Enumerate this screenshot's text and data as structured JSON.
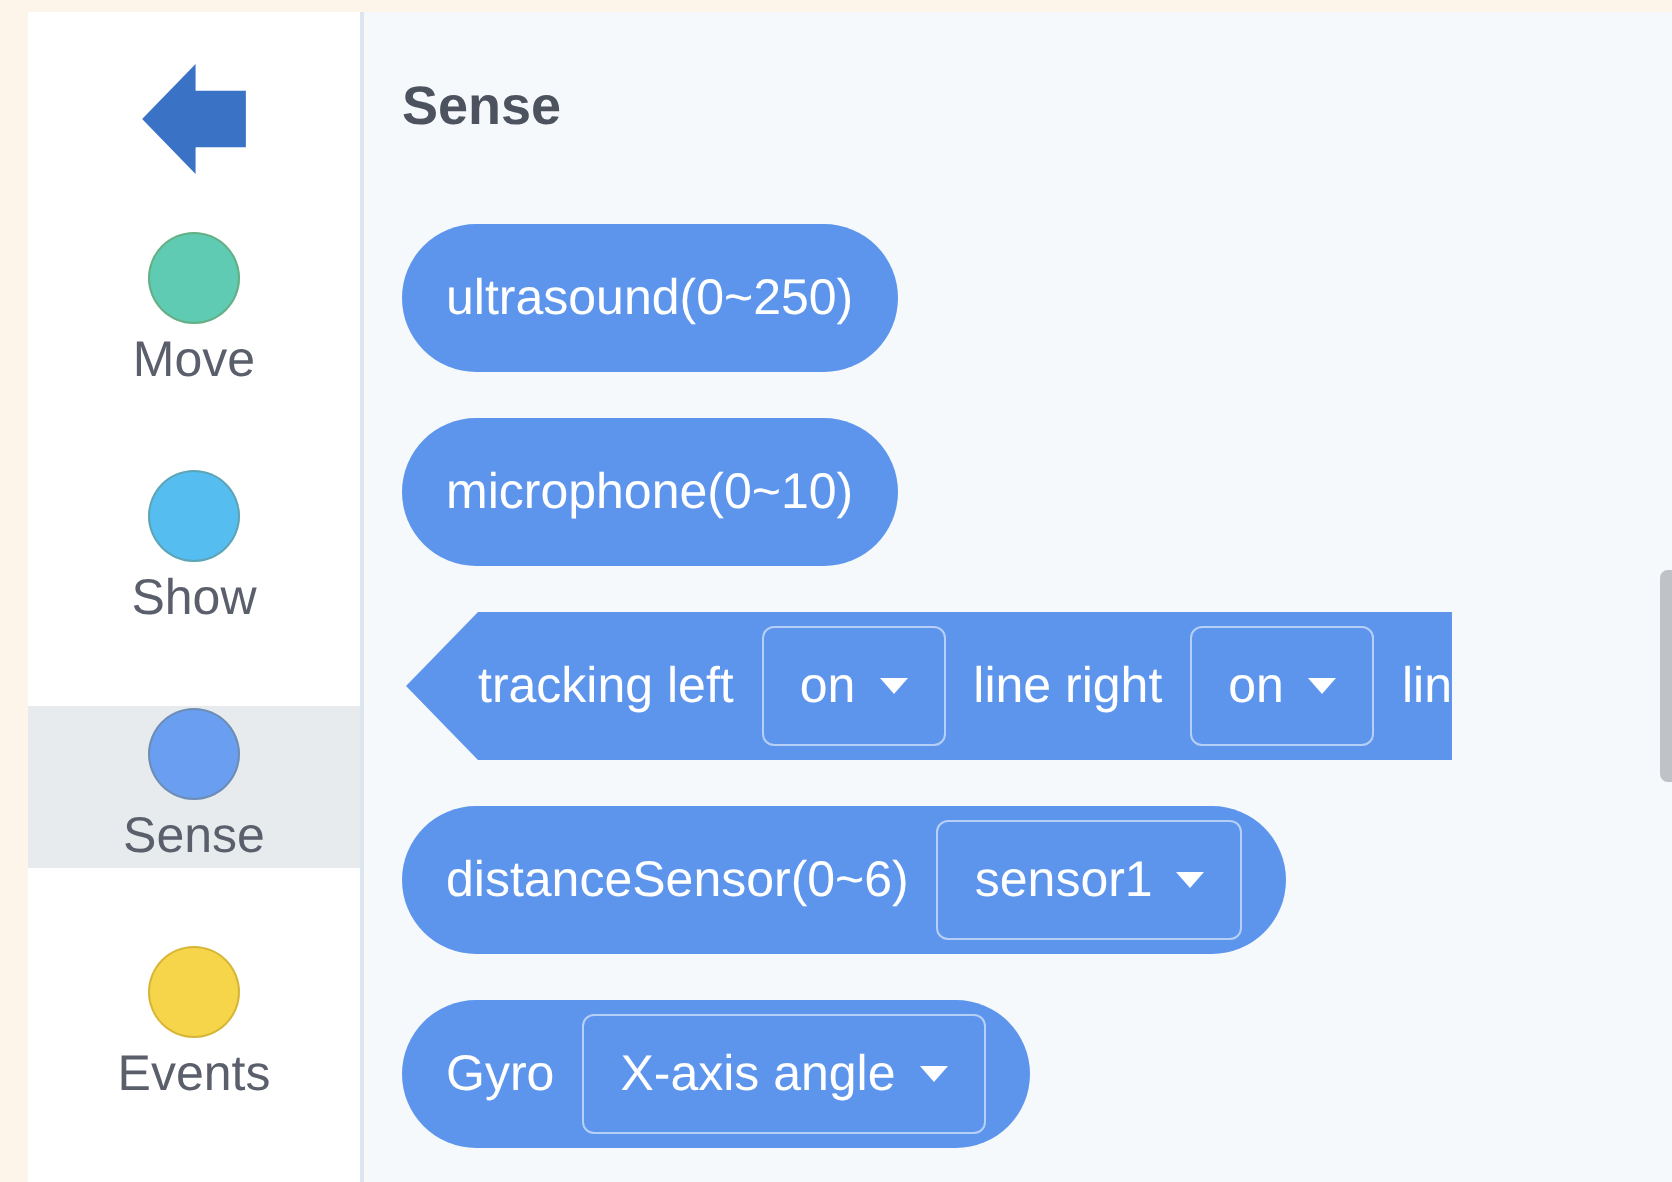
{
  "sidebar": {
    "categories": [
      {
        "label": "Move",
        "color": "#5fcbb2",
        "selected": false
      },
      {
        "label": "Show",
        "color": "#55bdf0",
        "selected": false
      },
      {
        "label": "Sense",
        "color": "#6a9ef0",
        "selected": true
      },
      {
        "label": "Events",
        "color": "#f7d54a",
        "selected": false
      }
    ]
  },
  "palette": {
    "title": "Sense",
    "blocks": [
      {
        "kind": "reporter",
        "parts": [
          {
            "kind": "text",
            "text": "ultrasound(0~250)"
          }
        ]
      },
      {
        "kind": "reporter",
        "parts": [
          {
            "kind": "text",
            "text": "microphone(0~10)"
          }
        ]
      },
      {
        "kind": "boolean",
        "parts": [
          {
            "kind": "text",
            "text": "tracking left"
          },
          {
            "kind": "dropdown",
            "text": "on"
          },
          {
            "kind": "text",
            "text": "line right"
          },
          {
            "kind": "dropdown",
            "text": "on"
          },
          {
            "kind": "text",
            "text": "lin"
          }
        ]
      },
      {
        "kind": "reporter",
        "parts": [
          {
            "kind": "text",
            "text": "distanceSensor(0~6)"
          },
          {
            "kind": "dropdown",
            "text": "sensor1"
          }
        ]
      },
      {
        "kind": "reporter",
        "parts": [
          {
            "kind": "text",
            "text": "Gyro"
          },
          {
            "kind": "dropdown",
            "text": "X-axis angle"
          }
        ]
      }
    ]
  }
}
